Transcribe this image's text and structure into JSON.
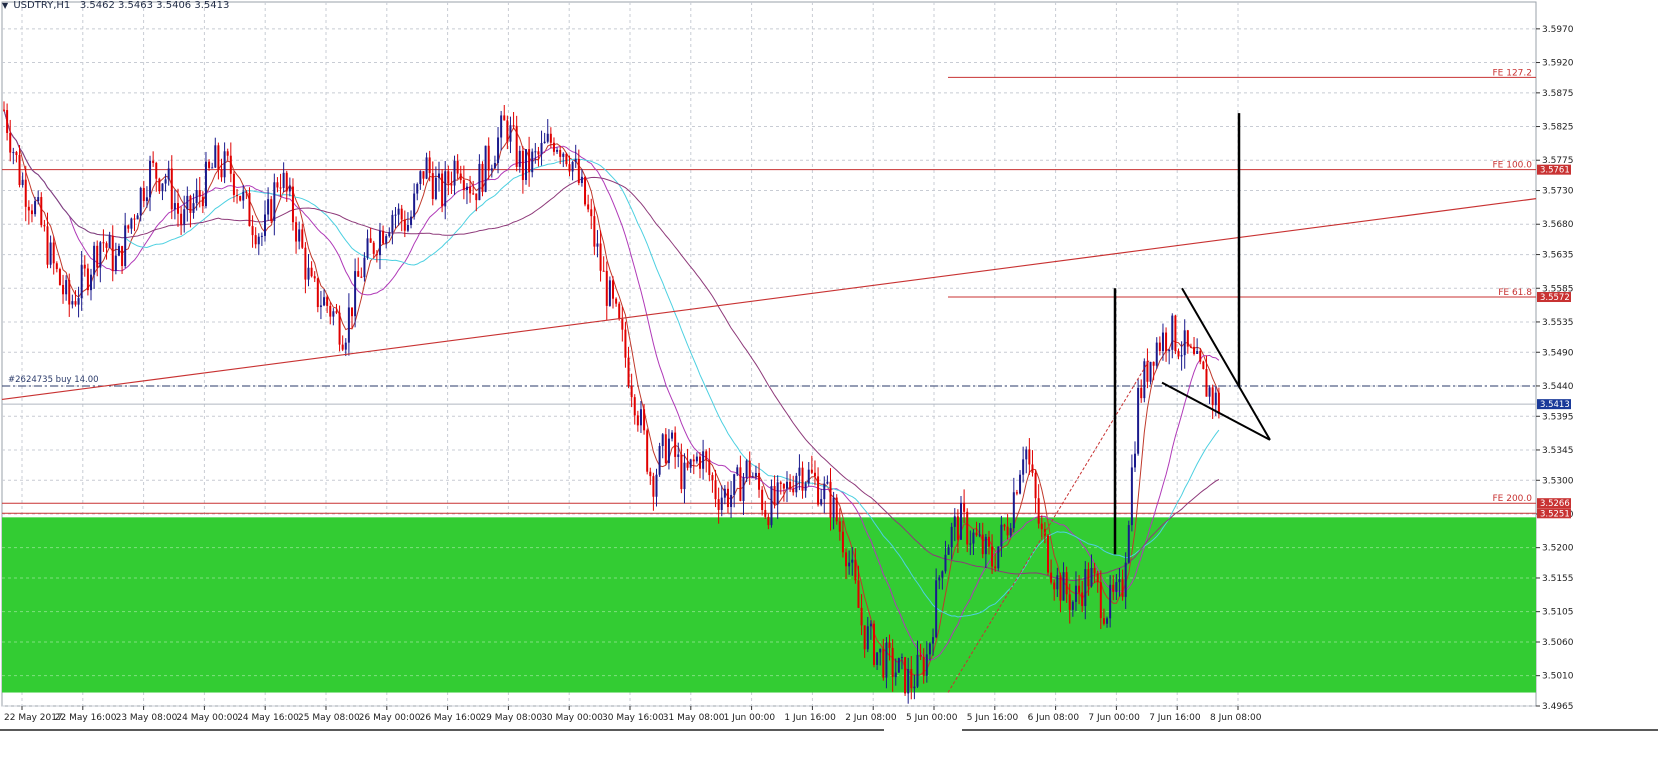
{
  "header": {
    "symbol_tf": "USDTRY,H1",
    "ohlc": "3.5462 3.5463 3.5406 3.5413"
  },
  "colors": {
    "background": "#ffffff",
    "grid": "#c8ccd4",
    "bull": "#1a1a8c",
    "bear": "#e00000",
    "ema_fast": "#c0392b",
    "ma_cyan": "#4dd0e1",
    "ma_purple": "#b03ab8",
    "ma_violet": "#8e3a7a",
    "zone": "#33cc33",
    "level": "#c83232",
    "price_tag": "#1a3a99",
    "trade_line": "#2a3a6a",
    "pattern": "#000000"
  },
  "chart_data": {
    "type": "candlestick",
    "title": "USDTRY,H1",
    "ylim": [
      3.4965,
      3.5995
    ],
    "y_ticks": [
      "3.5970",
      "3.5920",
      "3.5875",
      "3.5825",
      "3.5775",
      "3.5730",
      "3.5680",
      "3.5635",
      "3.5585",
      "3.5535",
      "3.5490",
      "3.5440",
      "3.5395",
      "3.5345",
      "3.5300",
      "3.5250",
      "3.5200",
      "3.5155",
      "3.5105",
      "3.5060",
      "3.5010",
      "3.4965"
    ],
    "x_ticks": [
      "22 May 2017",
      "22 May 16:00",
      "23 May 08:00",
      "24 May 00:00",
      "24 May 16:00",
      "25 May 08:00",
      "26 May 00:00",
      "26 May 16:00",
      "29 May 08:00",
      "30 May 00:00",
      "30 May 16:00",
      "31 May 08:00",
      "1 Jun 00:00",
      "1 Jun 16:00",
      "2 Jun 08:00",
      "5 Jun 00:00",
      "5 Jun 16:00",
      "6 Jun 08:00",
      "7 Jun 00:00",
      "7 Jun 16:00",
      "8 Jun 08:00"
    ],
    "close_path": [
      3.585,
      3.575,
      3.57,
      3.562,
      3.556,
      3.56,
      3.566,
      3.562,
      3.57,
      3.576,
      3.575,
      3.568,
      3.572,
      3.577,
      3.576,
      3.57,
      3.566,
      3.576,
      3.568,
      3.558,
      3.556,
      3.552,
      3.561,
      3.566,
      3.57,
      3.568,
      3.577,
      3.572,
      3.578,
      3.573,
      3.578,
      3.583,
      3.576,
      3.578,
      3.581,
      3.578,
      3.57,
      3.56,
      3.552,
      3.542,
      3.53,
      3.536,
      3.53,
      3.534,
      3.528,
      3.528,
      3.532,
      3.526,
      3.527,
      3.532,
      3.53,
      3.527,
      3.52,
      3.508,
      3.504,
      3.502,
      3.5,
      3.504,
      3.52,
      3.524,
      3.521,
      3.518,
      3.524,
      3.536,
      3.522,
      3.515,
      3.512,
      3.516,
      3.511,
      3.513,
      3.542,
      3.55,
      3.552,
      3.549,
      3.545,
      3.541
    ],
    "levels": [
      {
        "label": "FE 127.2",
        "price": 3.5898
      },
      {
        "label": "FE 100.0",
        "price": 3.5761,
        "tag": "3.5761"
      },
      {
        "label": "FE 61.8",
        "price": 3.5572,
        "tag": "3.5572"
      },
      {
        "label": "FE 200.0",
        "price": 3.5266,
        "tag": "3.5266"
      },
      {
        "price": 3.5251,
        "tag": "3.5251"
      }
    ],
    "current_price": {
      "price": 3.5413,
      "tag": "3.5413"
    },
    "trade_line": {
      "price": 3.544,
      "label": "#2624735 buy 14.00"
    },
    "zone": {
      "top": 3.5245,
      "bottom": 3.4985
    }
  }
}
